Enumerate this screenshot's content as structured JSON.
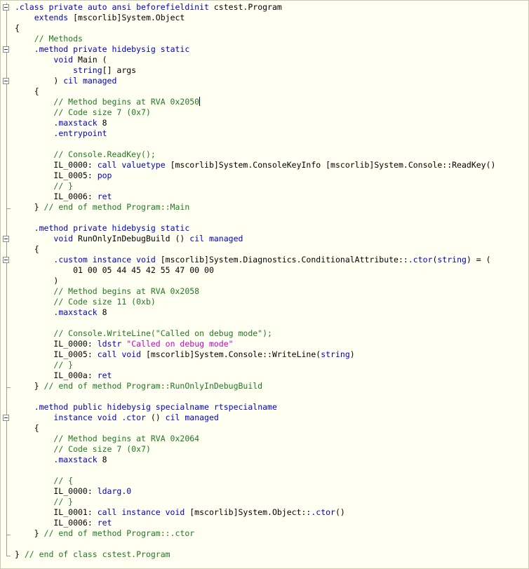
{
  "editor": {
    "colors": {
      "keyword": "#0000cc",
      "comment": "#1f7a1f",
      "string": "#cc00cc",
      "background": "#fffff2"
    },
    "lines": [
      [
        {
          "t": ".class private auto ansi beforefieldinit",
          "c": "kw"
        },
        {
          "t": " cstest.Program",
          "c": ""
        }
      ],
      [
        {
          "t": "    ",
          "c": ""
        },
        {
          "t": "extends",
          "c": "kw"
        },
        {
          "t": " [mscorlib]System.Object",
          "c": ""
        }
      ],
      [
        {
          "t": "{",
          "c": ""
        }
      ],
      [
        {
          "t": "    ",
          "c": ""
        },
        {
          "t": "// Methods",
          "c": "cm"
        }
      ],
      [
        {
          "t": "    ",
          "c": ""
        },
        {
          "t": ".method private hidebysig static",
          "c": "kw"
        }
      ],
      [
        {
          "t": "        ",
          "c": ""
        },
        {
          "t": "void",
          "c": "kw"
        },
        {
          "t": " Main (",
          "c": ""
        }
      ],
      [
        {
          "t": "            ",
          "c": ""
        },
        {
          "t": "string",
          "c": "kw"
        },
        {
          "t": "[] args",
          "c": ""
        }
      ],
      [
        {
          "t": "        ) ",
          "c": ""
        },
        {
          "t": "cil managed",
          "c": "kw"
        }
      ],
      [
        {
          "t": "    {",
          "c": ""
        }
      ],
      [
        {
          "t": "        ",
          "c": ""
        },
        {
          "t": "// Method begins at RVA 0x2050",
          "c": "cm"
        },
        {
          "t": "",
          "c": "cursor"
        }
      ],
      [
        {
          "t": "        ",
          "c": ""
        },
        {
          "t": "// Code size 7 (0x7)",
          "c": "cm"
        }
      ],
      [
        {
          "t": "        ",
          "c": ""
        },
        {
          "t": ".maxstack",
          "c": "kw"
        },
        {
          "t": " 8",
          "c": ""
        }
      ],
      [
        {
          "t": "        ",
          "c": ""
        },
        {
          "t": ".entrypoint",
          "c": "kw"
        }
      ],
      [
        {
          "t": "",
          "c": ""
        }
      ],
      [
        {
          "t": "        ",
          "c": ""
        },
        {
          "t": "// Console.ReadKey();",
          "c": "cm"
        }
      ],
      [
        {
          "t": "        IL_0000: ",
          "c": ""
        },
        {
          "t": "call valuetype",
          "c": "kw"
        },
        {
          "t": " [mscorlib]System.ConsoleKeyInfo [mscorlib]System.Console::ReadKey()",
          "c": ""
        }
      ],
      [
        {
          "t": "        IL_0005: ",
          "c": ""
        },
        {
          "t": "pop",
          "c": "kw"
        }
      ],
      [
        {
          "t": "        ",
          "c": ""
        },
        {
          "t": "// }",
          "c": "cm"
        }
      ],
      [
        {
          "t": "        IL_0006: ",
          "c": ""
        },
        {
          "t": "ret",
          "c": "kw"
        }
      ],
      [
        {
          "t": "    } ",
          "c": ""
        },
        {
          "t": "// end of method Program::Main",
          "c": "cm"
        }
      ],
      [
        {
          "t": "",
          "c": ""
        }
      ],
      [
        {
          "t": "    ",
          "c": ""
        },
        {
          "t": ".method private hidebysig static",
          "c": "kw"
        }
      ],
      [
        {
          "t": "        ",
          "c": ""
        },
        {
          "t": "void",
          "c": "kw"
        },
        {
          "t": " RunOnlyInDebugBuild () ",
          "c": ""
        },
        {
          "t": "cil managed",
          "c": "kw"
        }
      ],
      [
        {
          "t": "    {",
          "c": ""
        }
      ],
      [
        {
          "t": "        ",
          "c": ""
        },
        {
          "t": ".custom instance void",
          "c": "kw"
        },
        {
          "t": " [mscorlib]System.Diagnostics.ConditionalAttribute::",
          "c": ""
        },
        {
          "t": ".ctor",
          "c": "kw"
        },
        {
          "t": "(",
          "c": ""
        },
        {
          "t": "string",
          "c": "kw"
        },
        {
          "t": ") = (",
          "c": ""
        }
      ],
      [
        {
          "t": "            01 00 05 44 45 42 55 47 00 00",
          "c": ""
        }
      ],
      [
        {
          "t": "        )",
          "c": ""
        }
      ],
      [
        {
          "t": "        ",
          "c": ""
        },
        {
          "t": "// Method begins at RVA 0x2058",
          "c": "cm"
        }
      ],
      [
        {
          "t": "        ",
          "c": ""
        },
        {
          "t": "// Code size 11 (0xb)",
          "c": "cm"
        }
      ],
      [
        {
          "t": "        ",
          "c": ""
        },
        {
          "t": ".maxstack",
          "c": "kw"
        },
        {
          "t": " 8",
          "c": ""
        }
      ],
      [
        {
          "t": "",
          "c": ""
        }
      ],
      [
        {
          "t": "        ",
          "c": ""
        },
        {
          "t": "// Console.WriteLine(\"Called on debug mode\");",
          "c": "cm"
        }
      ],
      [
        {
          "t": "        IL_0000: ",
          "c": ""
        },
        {
          "t": "ldstr",
          "c": "kw"
        },
        {
          "t": " ",
          "c": ""
        },
        {
          "t": "\"Called on debug mode\"",
          "c": "st"
        }
      ],
      [
        {
          "t": "        IL_0005: ",
          "c": ""
        },
        {
          "t": "call void",
          "c": "kw"
        },
        {
          "t": " [mscorlib]System.Console::WriteLine(",
          "c": ""
        },
        {
          "t": "string",
          "c": "kw"
        },
        {
          "t": ")",
          "c": ""
        }
      ],
      [
        {
          "t": "        ",
          "c": ""
        },
        {
          "t": "// }",
          "c": "cm"
        }
      ],
      [
        {
          "t": "        IL_000a: ",
          "c": ""
        },
        {
          "t": "ret",
          "c": "kw"
        }
      ],
      [
        {
          "t": "    } ",
          "c": ""
        },
        {
          "t": "// end of method Program::RunOnlyInDebugBuild",
          "c": "cm"
        }
      ],
      [
        {
          "t": "",
          "c": ""
        }
      ],
      [
        {
          "t": "    ",
          "c": ""
        },
        {
          "t": ".method public hidebysig specialname rtspecialname",
          "c": "kw"
        }
      ],
      [
        {
          "t": "        ",
          "c": ""
        },
        {
          "t": "instance void .ctor",
          "c": "kw"
        },
        {
          "t": " () ",
          "c": ""
        },
        {
          "t": "cil managed",
          "c": "kw"
        }
      ],
      [
        {
          "t": "    {",
          "c": ""
        }
      ],
      [
        {
          "t": "        ",
          "c": ""
        },
        {
          "t": "// Method begins at RVA 0x2064",
          "c": "cm"
        }
      ],
      [
        {
          "t": "        ",
          "c": ""
        },
        {
          "t": "// Code size 7 (0x7)",
          "c": "cm"
        }
      ],
      [
        {
          "t": "        ",
          "c": ""
        },
        {
          "t": ".maxstack",
          "c": "kw"
        },
        {
          "t": " 8",
          "c": ""
        }
      ],
      [
        {
          "t": "",
          "c": ""
        }
      ],
      [
        {
          "t": "        ",
          "c": ""
        },
        {
          "t": "// {",
          "c": "cm"
        }
      ],
      [
        {
          "t": "        IL_0000: ",
          "c": ""
        },
        {
          "t": "ldarg.0",
          "c": "kw"
        }
      ],
      [
        {
          "t": "        ",
          "c": ""
        },
        {
          "t": "// }",
          "c": "cm"
        }
      ],
      [
        {
          "t": "        IL_0001: ",
          "c": ""
        },
        {
          "t": "call instance void",
          "c": "kw"
        },
        {
          "t": " [mscorlib]System.Object::",
          "c": ""
        },
        {
          "t": ".ctor",
          "c": "kw"
        },
        {
          "t": "()",
          "c": ""
        }
      ],
      [
        {
          "t": "        IL_0006: ",
          "c": ""
        },
        {
          "t": "ret",
          "c": "kw"
        }
      ],
      [
        {
          "t": "    } ",
          "c": ""
        },
        {
          "t": "// end of method Program::.ctor",
          "c": "cm"
        }
      ],
      [
        {
          "t": "",
          "c": ""
        }
      ],
      [
        {
          "t": "} ",
          "c": ""
        },
        {
          "t": "// end of class cstest.Program",
          "c": "cm"
        }
      ]
    ]
  }
}
